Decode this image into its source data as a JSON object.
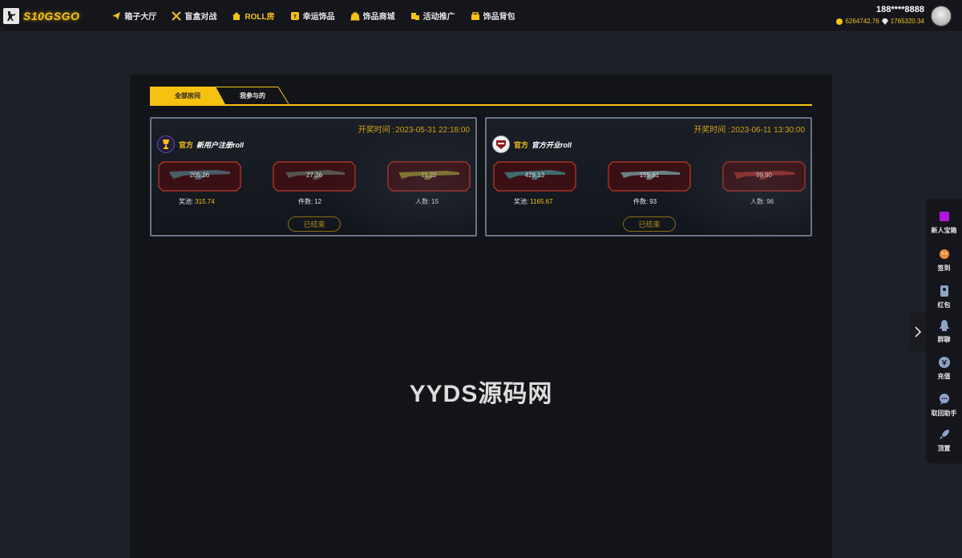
{
  "header": {
    "logo_text": "S10GSGO",
    "nav": [
      {
        "label": "箱子大厅",
        "icon": "paper-plane-icon"
      },
      {
        "label": "盲盒对战",
        "icon": "crossed-swords-icon"
      },
      {
        "label": "ROLL房",
        "icon": "house-icon",
        "active": true
      },
      {
        "label": "幸运饰品",
        "icon": "lucky-box-icon"
      },
      {
        "label": "饰品商城",
        "icon": "shopping-bag-icon"
      },
      {
        "label": "活动推广",
        "icon": "promo-icon"
      },
      {
        "label": "饰品背包",
        "icon": "backpack-icon"
      }
    ],
    "user": {
      "name": "188****8888",
      "coins": "6264742.76",
      "diamonds": "1765320.34"
    }
  },
  "tabs": {
    "all_rooms": "全部房间",
    "joined": "我参与的"
  },
  "rooms": [
    {
      "time_label": "开奖时间 :",
      "time": "2023-05-31 22:18:00",
      "official": "官方",
      "name": "新用户注册roll",
      "items": [
        "205.26",
        "27.26",
        "11.22"
      ],
      "pool_label": "奖池:",
      "pool": "315.74",
      "count_label": "件数:",
      "count": "12",
      "people_label": "人数:",
      "people": "15",
      "status": "已结束"
    },
    {
      "time_label": "开奖时间 :",
      "time": "2023-06-11 13:30:00",
      "official": "官方",
      "name": "官方开业roll",
      "items": [
        "428.13",
        "159.61",
        "99.90"
      ],
      "pool_label": "奖池:",
      "pool": "1165.67",
      "count_label": "件数:",
      "count": "93",
      "people_label": "人数:",
      "people": "96",
      "status": "已结束"
    }
  ],
  "watermark": "YYDS源码网",
  "sidebar": [
    {
      "label": "新人宝箱",
      "icon": "gift-box-icon"
    },
    {
      "label": "签到",
      "icon": "sign-in-icon"
    },
    {
      "label": "红包",
      "icon": "red-envelope-icon"
    },
    {
      "label": "群聊",
      "icon": "qq-penguin-icon"
    },
    {
      "label": "充值",
      "icon": "recharge-icon"
    },
    {
      "label": "取回助手",
      "icon": "chat-bubble-icon"
    },
    {
      "label": "顶置",
      "icon": "rocket-icon"
    }
  ],
  "colors": {
    "accent": "#f5c211",
    "background": "#1e2027",
    "panel": "#131418",
    "item_border": "#c0392b"
  }
}
